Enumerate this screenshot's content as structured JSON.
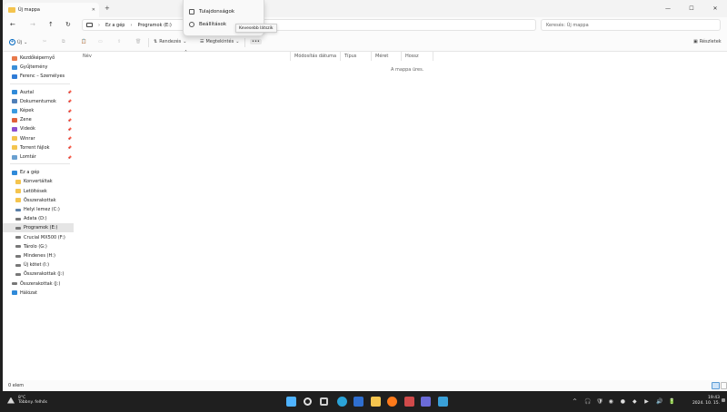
{
  "window": {
    "tab_title": "Új mappa",
    "tab_close": "✕",
    "new_tab": "+",
    "minimize": "—",
    "maximize": "☐",
    "close": "✕"
  },
  "nav": {
    "back": "←",
    "forward": "→",
    "up": "↑",
    "refresh": "↻"
  },
  "address": {
    "crumbs": [
      "Ez a gép",
      "Programok (E:)"
    ],
    "separator": "›"
  },
  "search": {
    "placeholder": "Keresés: Új mappa"
  },
  "toolbar": {
    "new_label": "Új",
    "sort_label": "Rendezés",
    "view_label": "Megtekintés",
    "more_label": "•••",
    "details_label": "Részletek"
  },
  "context_menu": {
    "items": [
      "Tulajdonságok",
      "Beállítások"
    ]
  },
  "tooltip": "Kevesebb látszik",
  "sidebar": {
    "quick": [
      {
        "label": "Kezdőképernyő",
        "icon": "home-icon",
        "color": "#e8794a"
      },
      {
        "label": "Gyűjtemény",
        "icon": "gallery-icon",
        "color": "#3a8fd8"
      },
      {
        "label": "Ferenc – Személyes",
        "icon": "cloud-icon",
        "color": "#2f7bd6"
      }
    ],
    "pinned": [
      {
        "label": "Asztal",
        "icon": "desktop-icon",
        "color": "#2f8ad9"
      },
      {
        "label": "Dokumentumok",
        "icon": "documents-icon",
        "color": "#4f7fb8"
      },
      {
        "label": "Képek",
        "icon": "pictures-icon",
        "color": "#3a9be0"
      },
      {
        "label": "Zene",
        "icon": "music-icon",
        "color": "#e0603a"
      },
      {
        "label": "Videók",
        "icon": "videos-icon",
        "color": "#8c4fd0"
      },
      {
        "label": "Winrar",
        "icon": "folder-icon",
        "color": "#f4c44e"
      },
      {
        "label": "Torrent fájlok",
        "icon": "folder-icon",
        "color": "#f4c44e"
      },
      {
        "label": "Lomtár",
        "icon": "recycle-bin-icon",
        "color": "#6aa0d0"
      }
    ],
    "pin_glyph": "📌",
    "tree": [
      {
        "label": "Ez a gép",
        "icon": "pc-icon",
        "color": "#2f8ad9",
        "indent": 1
      },
      {
        "label": "Konvertáltak",
        "icon": "folder-icon",
        "color": "#f4c44e",
        "indent": 2
      },
      {
        "label": "Letöltések",
        "icon": "folder-icon",
        "color": "#f4c44e",
        "indent": 2
      },
      {
        "label": "Összerakottak",
        "icon": "folder-icon",
        "color": "#f4c44e",
        "indent": 2
      },
      {
        "label": "Helyi lemez (C:)",
        "icon": "drive-icon",
        "color": "#5a7fa8",
        "indent": 2
      },
      {
        "label": "Adata (D:)",
        "icon": "drive-icon",
        "color": "#777777",
        "indent": 2
      },
      {
        "label": "Programok (E:)",
        "icon": "drive-icon",
        "color": "#777777",
        "indent": 2,
        "selected": true
      },
      {
        "label": "Crucial MX500 (F:)",
        "icon": "drive-icon",
        "color": "#777777",
        "indent": 2
      },
      {
        "label": "Tárolo (G:)",
        "icon": "drive-icon",
        "color": "#777777",
        "indent": 2
      },
      {
        "label": "Mindenes (H:)",
        "icon": "drive-icon",
        "color": "#777777",
        "indent": 2
      },
      {
        "label": "Új kötet (I:)",
        "icon": "drive-icon",
        "color": "#777777",
        "indent": 2
      },
      {
        "label": "Összerakottak (J:)",
        "icon": "drive-icon",
        "color": "#777777",
        "indent": 2
      },
      {
        "label": "Összerakottak (J:)",
        "icon": "drive-icon",
        "color": "#777777",
        "indent": 1
      },
      {
        "label": "Hálózat",
        "icon": "network-icon",
        "color": "#2f8ad9",
        "indent": 1
      }
    ]
  },
  "columns": [
    "Név",
    "Módosítás dátuma",
    "Típus",
    "Méret",
    "Hossz"
  ],
  "empty_message": "A mappa üres.",
  "status": {
    "count": "0 elem"
  },
  "taskbar": {
    "weather_temp": "8°C",
    "weather_desc": "Többny. felhős",
    "apps": [
      {
        "icon": "start-icon",
        "color": "#4fb3ff"
      },
      {
        "icon": "search-icon",
        "color": "#e0e0e0"
      },
      {
        "icon": "task-view-icon",
        "color": "#cfcfcf"
      },
      {
        "icon": "edge-icon",
        "color": "#2aa3d8"
      },
      {
        "icon": "outlook-icon",
        "color": "#2f6fd0"
      },
      {
        "icon": "explorer-icon",
        "color": "#f4c44e"
      },
      {
        "icon": "firefox-icon",
        "color": "#ff7a1a"
      },
      {
        "icon": "app-icon",
        "color": "#d04a4a"
      },
      {
        "icon": "app-icon",
        "color": "#6b6bd8"
      },
      {
        "icon": "app-icon",
        "color": "#3aa0d8"
      }
    ],
    "tray": [
      "^",
      "🎧",
      "🛡",
      "◉",
      "●",
      "◆",
      "▶",
      "🔊",
      "🔋"
    ],
    "time": "19:43",
    "date": "2024. 10. 15."
  }
}
